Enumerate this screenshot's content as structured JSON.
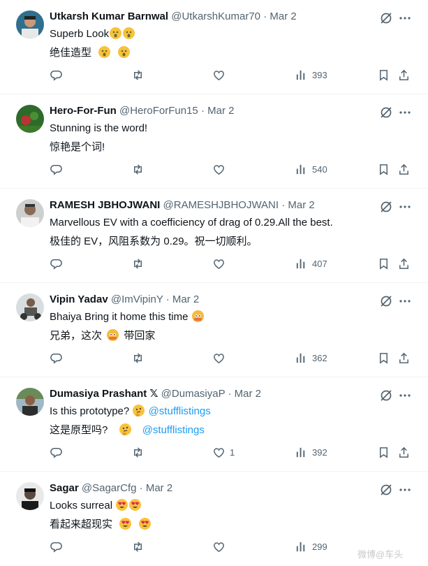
{
  "tweets": [
    {
      "name": "Utkarsh Kumar Barnwal",
      "handle": "@UtkarshKumar70",
      "date": "Mar 2",
      "text": "Superb Look",
      "translation": "绝佳造型",
      "replies": "",
      "retweets": "",
      "likes": "",
      "views": "393",
      "text_emoji": [
        "astonished",
        "astonished"
      ],
      "translation_emoji": [
        "astonished",
        "astonished"
      ]
    },
    {
      "name": "Hero-For-Fun",
      "handle": "@HeroForFun15",
      "date": "Mar 2",
      "text": "Stunning is the word!",
      "translation": "惊艳是个词!",
      "replies": "",
      "retweets": "",
      "likes": "",
      "views": "540",
      "text_emoji": [],
      "translation_emoji": []
    },
    {
      "name": "RAMESH JBHOJWANI",
      "handle": "@RAMESHJBHOJWANI",
      "date": "Mar 2",
      "text": "Marvellous EV with a coefficiency of drag of 0.29.All the best.",
      "translation": "极佳的 EV，风阻系数为 0.29。祝一切顺利。",
      "replies": "",
      "retweets": "",
      "likes": "",
      "views": "407",
      "text_emoji": [],
      "translation_emoji": []
    },
    {
      "name": "Vipin Yadav",
      "handle": "@ImVipinY",
      "date": "Mar 2",
      "text": "Bhaiya Bring it home this time",
      "translation_pre": "兄弟，这次",
      "translation_post": "带回家",
      "replies": "",
      "retweets": "",
      "likes": "",
      "views": "362",
      "text_emoji": [
        "pleading"
      ],
      "translation_emoji": [
        "pleading"
      ]
    },
    {
      "name": "Dumasiya Prashant",
      "verified_mark": "𝕏",
      "handle": "@DumasiyaP",
      "date": "Mar 2",
      "text": "Is this prototype?",
      "mention": "@stufflistings",
      "translation": "这是原型吗?",
      "replies": "",
      "retweets": "",
      "likes": "1",
      "views": "392",
      "text_emoji": [
        "thinking"
      ],
      "translation_emoji": [
        "thinking"
      ]
    },
    {
      "name": "Sagar",
      "handle": "@SagarCfg",
      "date": "Mar 2",
      "text": "Looks surreal",
      "translation": "看起来超现实",
      "replies": "",
      "retweets": "",
      "likes": "",
      "views": "299",
      "text_emoji": [
        "heart-eyes",
        "heart-eyes"
      ],
      "translation_emoji": [
        "heart-eyes",
        "heart-eyes"
      ]
    }
  ],
  "watermark": "微博@车头",
  "colors": {
    "text": "#0f1419",
    "secondary": "#536471",
    "mention": "#1d9bf0",
    "divider": "#eff3f4"
  },
  "icons": [
    "reply-icon",
    "retweet-icon",
    "like-icon",
    "views-icon",
    "bookmark-icon",
    "share-icon",
    "grok-icon",
    "more-icon"
  ]
}
